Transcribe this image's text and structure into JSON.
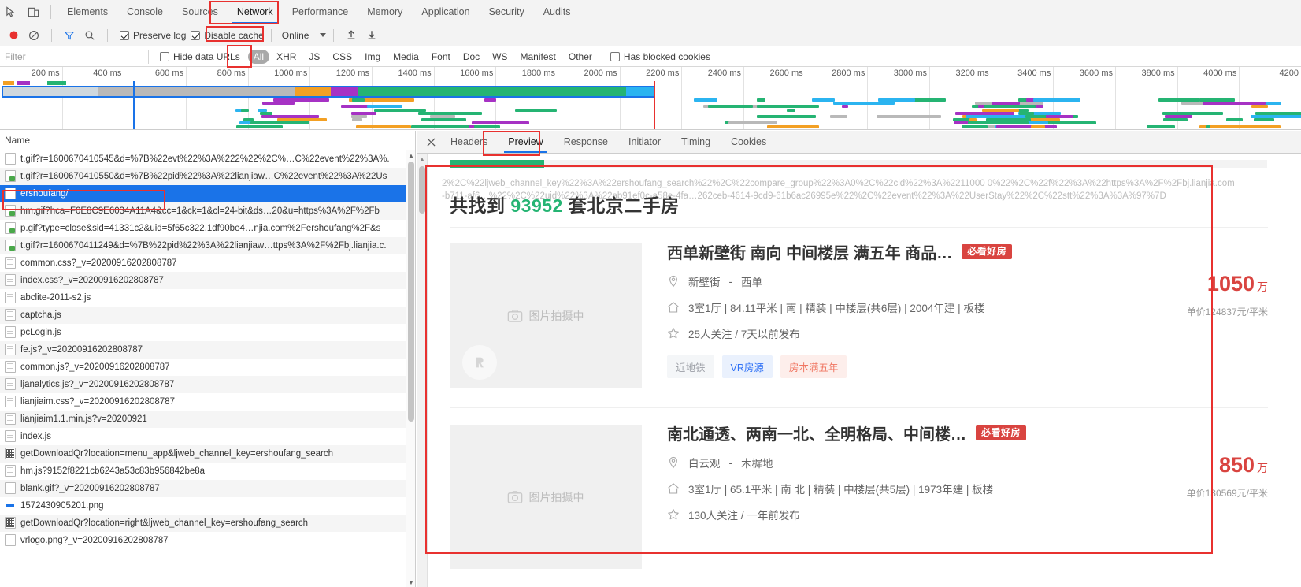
{
  "devtools": {
    "tabs": [
      {
        "label": "Elements",
        "active": false
      },
      {
        "label": "Console",
        "active": false
      },
      {
        "label": "Sources",
        "active": false
      },
      {
        "label": "Network",
        "active": true
      },
      {
        "label": "Performance",
        "active": false
      },
      {
        "label": "Memory",
        "active": false
      },
      {
        "label": "Application",
        "active": false
      },
      {
        "label": "Security",
        "active": false
      },
      {
        "label": "Audits",
        "active": false
      }
    ],
    "controls": {
      "preserve_log_label": "Preserve log",
      "preserve_log_checked": true,
      "disable_cache_label": "Disable cache",
      "disable_cache_checked": true,
      "throttle_label": "Online"
    },
    "filter": {
      "placeholder": "Filter",
      "value": "",
      "hide_data_urls_label": "Hide data URLs",
      "hide_data_urls_checked": false,
      "types": [
        "All",
        "XHR",
        "JS",
        "CSS",
        "Img",
        "Media",
        "Font",
        "Doc",
        "WS",
        "Manifest",
        "Other"
      ],
      "active_type": "All",
      "has_blocked_cookies_label": "Has blocked cookies",
      "has_blocked_cookies_checked": false
    }
  },
  "overview": {
    "ticks": [
      "200 ms",
      "400 ms",
      "600 ms",
      "800 ms",
      "1000 ms",
      "1200 ms",
      "1400 ms",
      "1600 ms",
      "1800 ms",
      "2000 ms",
      "2200 ms",
      "2400 ms",
      "2600 ms",
      "2800 ms",
      "3000 ms",
      "3200 ms",
      "3400 ms",
      "3600 ms",
      "3800 ms",
      "4000 ms",
      "4200"
    ]
  },
  "request_list": {
    "column_header": "Name",
    "rows": [
      {
        "name": "t.gif?r=1600670410545&d=%7B%22evt%22%3A%222%22%2C%…C%22event%22%3A%.",
        "icon": "doc-icon",
        "selected": false
      },
      {
        "name": "t.gif?r=1600670410550&d=%7B%22pid%22%3A%22lianjiaw…C%22event%22%3A%22Us",
        "icon": "image-icon",
        "selected": false
      },
      {
        "name": "ershoufang/",
        "icon": "doc-icon",
        "selected": true
      },
      {
        "name": "hm.gif?hca=F0E8C9E6034A11A4&cc=1&ck=1&cl=24-bit&ds…20&u=https%3A%2F%2Fb",
        "icon": "image-icon",
        "selected": false
      },
      {
        "name": "p.gif?type=close&sid=41331c2&uid=5f65c322.1df90be4…njia.com%2Fershoufang%2F&s",
        "icon": "image-icon",
        "selected": false
      },
      {
        "name": "t.gif?r=1600670411249&d=%7B%22pid%22%3A%22lianjiaw…ttps%3A%2F%2Fbj.lianjia.c.",
        "icon": "image-icon",
        "selected": false
      },
      {
        "name": "common.css?_v=20200916202808787",
        "icon": "stylesheet-icon",
        "selected": false
      },
      {
        "name": "index.css?_v=20200916202808787",
        "icon": "stylesheet-icon",
        "selected": false
      },
      {
        "name": "abclite-2011-s2.js",
        "icon": "script-icon",
        "selected": false
      },
      {
        "name": "captcha.js",
        "icon": "script-icon",
        "selected": false
      },
      {
        "name": "pcLogin.js",
        "icon": "script-icon",
        "selected": false
      },
      {
        "name": "fe.js?_v=20200916202808787",
        "icon": "script-icon",
        "selected": false
      },
      {
        "name": "common.js?_v=20200916202808787",
        "icon": "script-icon",
        "selected": false
      },
      {
        "name": "ljanalytics.js?_v=20200916202808787",
        "icon": "script-icon",
        "selected": false
      },
      {
        "name": "lianjiaim.css?_v=20200916202808787",
        "icon": "stylesheet-icon",
        "selected": false
      },
      {
        "name": "lianjiaim1.1.min.js?v=20200921",
        "icon": "script-icon",
        "selected": false
      },
      {
        "name": "index.js",
        "icon": "script-icon",
        "selected": false
      },
      {
        "name": "getDownloadQr?location=menu_app&ljweb_channel_key=ershoufang_search",
        "icon": "qr-icon",
        "selected": false
      },
      {
        "name": "hm.js?9152f8221cb6243a53c83b956842be8a",
        "icon": "script-icon",
        "selected": false
      },
      {
        "name": "blank.gif?_v=20200916202808787",
        "icon": "doc-icon",
        "selected": false
      },
      {
        "name": "1572430905201.png",
        "icon": "png-icon",
        "selected": false
      },
      {
        "name": "getDownloadQr?location=right&ljweb_channel_key=ershoufang_search",
        "icon": "qr-icon",
        "selected": false
      },
      {
        "name": "vrlogo.png?_v=20200916202808787",
        "icon": "doc-icon",
        "selected": false
      }
    ]
  },
  "detail": {
    "close_label": "✕",
    "tabs": [
      {
        "label": "Headers",
        "active": false
      },
      {
        "label": "Preview",
        "active": true
      },
      {
        "label": "Response",
        "active": false
      },
      {
        "label": "Initiator",
        "active": false
      },
      {
        "label": "Timing",
        "active": false
      },
      {
        "label": "Cookies",
        "active": false
      }
    ]
  },
  "preview": {
    "ghost_line_1": "2%2C%22ljweb_channel_key%22%3A%22ershoufang_search%22%2C%22compare_group%22%3A0%2C%22cid%22%3A%2211000 0%22%2C%22f%22%3A%22https%3A%2F%2Fbj.lianjia.com",
    "ghost_line_2": "-b711-af6…%22%2C%22uid%22%3A%22ab91ef0c-a58e-4fa…262ceb-4614-9cd9-61b6ac26995e%22%2C%22event%22%3A%22UserStay%22%2C%22stt%22%3A%3A%97%7D",
    "result_prefix": "共找到 ",
    "result_count": "93952",
    "result_suffix": " 套北京二手房",
    "thumb_placeholder": "图片拍摄中",
    "listings": [
      {
        "title": "西单新壁街 南向 中间楼层 满五年 商品…",
        "badge": "必看好房",
        "community": "新壁街",
        "district": "西单",
        "specs": "3室1厅 | 84.11平米 | 南 | 精装 | 中楼层(共6层) | 2004年建 | 板楼",
        "follow": "25人关注 / 7天以前发布",
        "tags": [
          "近地铁",
          "VR房源",
          "房本满五年"
        ],
        "price": "1050",
        "price_unit": "万",
        "unit_price": "单价124837元/平米"
      },
      {
        "title": "南北通透、两南一北、全明格局、中间楼…",
        "badge": "必看好房",
        "community": "白云观",
        "district": "木樨地",
        "specs": "3室1厅 | 65.1平米 | 南 北 | 精装 | 中楼层(共5层) | 1973年建 | 板楼",
        "follow": "130人关注 / 一年前发布",
        "tags": [],
        "price": "850",
        "price_unit": "万",
        "unit_price": "单价130569元/平米"
      }
    ]
  },
  "colors": {
    "accent": "#1a73e8",
    "green": "#25b473",
    "red_badge": "#d94440",
    "annotation": "#e8312f"
  }
}
